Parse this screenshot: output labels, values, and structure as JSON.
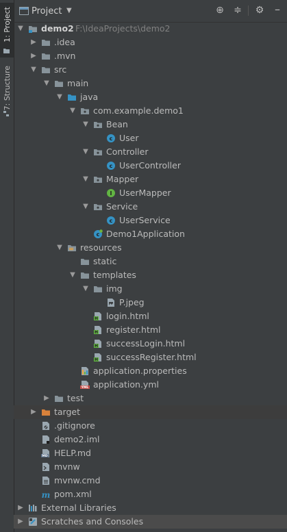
{
  "sidebar": {
    "project_tab": "1: Project",
    "structure_tab": "7: Structure"
  },
  "header": {
    "title": "Project",
    "icons": [
      "target-icon",
      "collapse-all-icon",
      "gear-icon",
      "hide-icon"
    ]
  },
  "tree": [
    {
      "label": "demo2",
      "path": "F:\\IdeaProjects\\demo2",
      "icon": "module-folder-icon",
      "depth": 0,
      "arrow": "down"
    },
    {
      "label": ".idea",
      "icon": "folder-icon",
      "depth": 1,
      "arrow": "right"
    },
    {
      "label": ".mvn",
      "icon": "folder-icon",
      "depth": 1,
      "arrow": "right"
    },
    {
      "label": "src",
      "icon": "folder-icon",
      "depth": 1,
      "arrow": "down"
    },
    {
      "label": "main",
      "icon": "folder-icon",
      "depth": 2,
      "arrow": "down"
    },
    {
      "label": "java",
      "icon": "source-folder-icon",
      "depth": 3,
      "arrow": "down"
    },
    {
      "label": "com.example.demo1",
      "icon": "package-icon",
      "depth": 4,
      "arrow": "down"
    },
    {
      "label": "Bean",
      "icon": "package-icon",
      "depth": 5,
      "arrow": "down"
    },
    {
      "label": "User",
      "icon": "class-icon",
      "depth": 6,
      "arrow": ""
    },
    {
      "label": "Controller",
      "icon": "package-icon",
      "depth": 5,
      "arrow": "down"
    },
    {
      "label": "UserController",
      "icon": "class-icon",
      "depth": 6,
      "arrow": ""
    },
    {
      "label": "Mapper",
      "icon": "package-icon",
      "depth": 5,
      "arrow": "down"
    },
    {
      "label": "UserMapper",
      "icon": "interface-icon",
      "depth": 6,
      "arrow": ""
    },
    {
      "label": "Service",
      "icon": "package-icon",
      "depth": 5,
      "arrow": "down"
    },
    {
      "label": "UserService",
      "icon": "class-icon",
      "depth": 6,
      "arrow": ""
    },
    {
      "label": "Demo1Application",
      "icon": "spring-class-icon",
      "depth": 5,
      "arrow": ""
    },
    {
      "label": "resources",
      "icon": "resources-folder-icon",
      "depth": 3,
      "arrow": "down"
    },
    {
      "label": "static",
      "icon": "folder-icon",
      "depth": 4,
      "arrow": ""
    },
    {
      "label": "templates",
      "icon": "folder-icon",
      "depth": 4,
      "arrow": "down"
    },
    {
      "label": "img",
      "icon": "folder-icon",
      "depth": 5,
      "arrow": "down"
    },
    {
      "label": "P.jpeg",
      "icon": "image-file-icon",
      "depth": 6,
      "arrow": ""
    },
    {
      "label": "login.html",
      "icon": "html-file-icon",
      "depth": 5,
      "arrow": ""
    },
    {
      "label": "register.html",
      "icon": "html-file-icon",
      "depth": 5,
      "arrow": ""
    },
    {
      "label": "successLogin.html",
      "icon": "html-file-icon",
      "depth": 5,
      "arrow": ""
    },
    {
      "label": "successRegister.html",
      "icon": "html-file-icon",
      "depth": 5,
      "arrow": ""
    },
    {
      "label": "application.properties",
      "icon": "properties-file-icon",
      "depth": 4,
      "arrow": ""
    },
    {
      "label": "application.yml",
      "icon": "yml-file-icon",
      "depth": 4,
      "arrow": ""
    },
    {
      "label": "test",
      "icon": "folder-icon",
      "depth": 2,
      "arrow": "right"
    },
    {
      "label": "target",
      "icon": "excluded-folder-icon",
      "depth": 1,
      "arrow": "right",
      "highlight": true
    },
    {
      "label": ".gitignore",
      "icon": "gitignore-file-icon",
      "depth": 1,
      "arrow": ""
    },
    {
      "label": "demo2.iml",
      "icon": "iml-file-icon",
      "depth": 1,
      "arrow": ""
    },
    {
      "label": "HELP.md",
      "icon": "markdown-file-icon",
      "depth": 1,
      "arrow": ""
    },
    {
      "label": "mvnw",
      "icon": "shell-file-icon",
      "depth": 1,
      "arrow": ""
    },
    {
      "label": "mvnw.cmd",
      "icon": "text-file-icon",
      "depth": 1,
      "arrow": ""
    },
    {
      "label": "pom.xml",
      "icon": "maven-file-icon",
      "depth": 1,
      "arrow": ""
    },
    {
      "label": "External Libraries",
      "icon": "libraries-icon",
      "depth": 0,
      "arrow": "right"
    },
    {
      "label": "Scratches and Consoles",
      "icon": "scratches-icon",
      "depth": 0,
      "arrow": "right",
      "selected": true
    }
  ]
}
